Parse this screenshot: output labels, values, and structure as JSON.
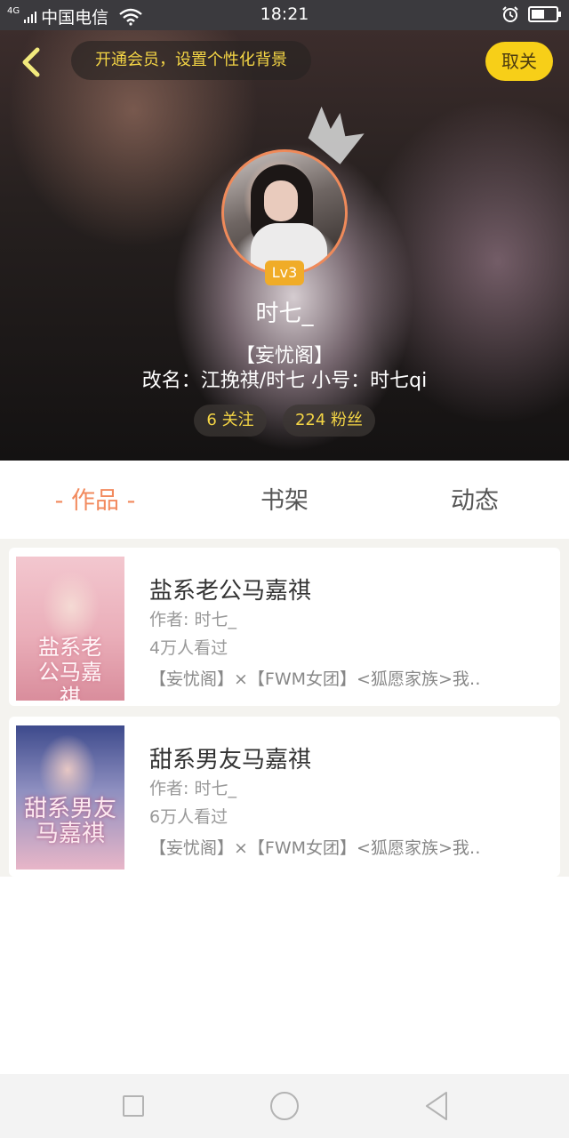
{
  "status_bar": {
    "network": "4G",
    "carrier": "中国电信",
    "time": "18:21"
  },
  "header": {
    "vip_banner": "开通会员，设置个性化背景",
    "unfollow_label": "取关",
    "level": "Lv3",
    "username": "时七_",
    "bio_line1": "【妄忧阁】",
    "bio_line2": "改名：江挽祺/时七 小号：时七qi",
    "following": "6 关注",
    "fans": "224 粉丝"
  },
  "tabs": {
    "works": "- 作品 -",
    "shelf": "书架",
    "moments": "动态"
  },
  "books": [
    {
      "title": "盐系老公马嘉祺",
      "author": "作者: 时七_",
      "views": "4万人看过",
      "description": "【妄忧阁】×【FWM女团】<狐愿家族>我…",
      "cover_text": "盐系老公马嘉祺"
    },
    {
      "title": "甜系男友马嘉祺",
      "author": "作者: 时七_",
      "views": "6万人看过",
      "description": "【妄忧阁】×【FWM女团】<狐愿家族>我…",
      "cover_text": "甜系男友马嘉祺"
    }
  ],
  "colors": {
    "accent_yellow": "#f7cf18",
    "active_tab": "#f28a5e",
    "level_badge": "#f0ac28"
  },
  "icons": {
    "back": "back-arrow-icon",
    "crown": "crown-icon",
    "nav_recent": "square-icon",
    "nav_home": "circle-icon",
    "nav_back": "triangle-back-icon"
  }
}
